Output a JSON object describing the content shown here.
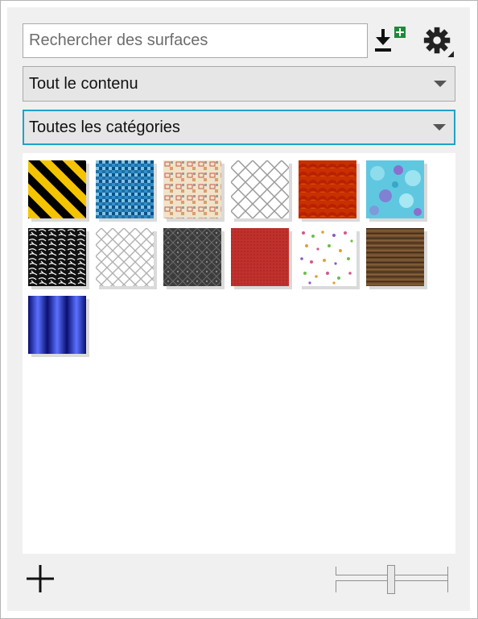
{
  "search": {
    "placeholder": "Rechercher des surfaces",
    "value": ""
  },
  "toolbar": {
    "download_icon": "download-add-icon",
    "settings_icon": "gear-icon"
  },
  "filters": {
    "content_selected": "Tout le contenu",
    "category_selected": "Toutes les catégories"
  },
  "fills": [
    {
      "name": "hazard-stripes",
      "colors": [
        "#f5c400",
        "#000000"
      ]
    },
    {
      "name": "blue-mosaic",
      "colors": [
        "#1f6fa8",
        "#7fc4e6"
      ]
    },
    {
      "name": "retro-squares",
      "colors": [
        "#efe3c9",
        "#c95a4a"
      ]
    },
    {
      "name": "chain-link-white",
      "colors": [
        "#ffffff",
        "#9a9a9a"
      ]
    },
    {
      "name": "orange-scales",
      "colors": [
        "#e8480c",
        "#ffb000"
      ]
    },
    {
      "name": "aqua-bubbles",
      "colors": [
        "#5fc8e0",
        "#8a6fcf"
      ]
    },
    {
      "name": "black-white-floral",
      "colors": [
        "#000000",
        "#ffffff"
      ]
    },
    {
      "name": "chain-link-grey",
      "colors": [
        "#ffffff",
        "#b0b0b0"
      ]
    },
    {
      "name": "dark-diamond",
      "colors": [
        "#3c3c3c",
        "#6c6c6c"
      ]
    },
    {
      "name": "red-texture",
      "colors": [
        "#c0302c",
        "#a82824"
      ]
    },
    {
      "name": "confetti-dots",
      "colors": [
        "#ffffff",
        "#d05a8a"
      ]
    },
    {
      "name": "wood-planks",
      "colors": [
        "#6b4a2a",
        "#3a2716"
      ]
    },
    {
      "name": "blue-metal-bars",
      "colors": [
        "#1a22a8",
        "#5b70ff"
      ]
    }
  ],
  "footer": {
    "add_icon": "plus-icon",
    "zoom_level": 0.5
  }
}
